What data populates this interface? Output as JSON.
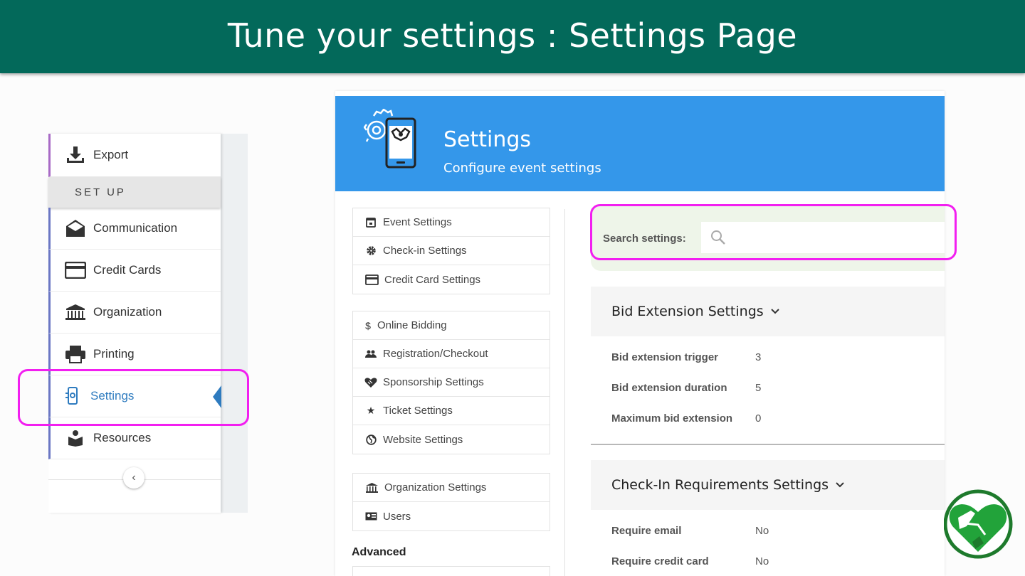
{
  "banner": {
    "title": "Tune your settings : Settings Page"
  },
  "sidebar": {
    "export_label": "Export",
    "setup_label": "SET UP",
    "items": [
      {
        "label": "Communication",
        "icon": "envelope-icon"
      },
      {
        "label": "Credit Cards",
        "icon": "credit-card-icon"
      },
      {
        "label": "Organization",
        "icon": "building-icon"
      },
      {
        "label": "Printing",
        "icon": "printer-icon"
      },
      {
        "label": "Settings",
        "icon": "phone-settings-icon",
        "active": true
      },
      {
        "label": "Resources",
        "icon": "resources-icon"
      }
    ],
    "collapse_glyph": "‹"
  },
  "panel": {
    "title": "Settings",
    "subtitle": "Configure event settings",
    "menu_groups": [
      [
        {
          "label": "Event Settings",
          "icon": "calendar-icon"
        },
        {
          "label": "Check-in Settings",
          "icon": "gear-icon"
        },
        {
          "label": "Credit Card Settings",
          "icon": "credit-card-icon"
        }
      ],
      [
        {
          "label": "Online Bidding",
          "icon": "dollar-icon"
        },
        {
          "label": "Registration/Checkout",
          "icon": "people-icon"
        },
        {
          "label": "Sponsorship Settings",
          "icon": "handshake-heart-icon"
        },
        {
          "label": "Ticket Settings",
          "icon": "star-icon"
        },
        {
          "label": "Website Settings",
          "icon": "globe-icon"
        }
      ],
      [
        {
          "label": "Organization Settings",
          "icon": "building-icon"
        },
        {
          "label": "Users",
          "icon": "id-card-icon"
        }
      ]
    ],
    "advanced_label": "Advanced",
    "search": {
      "label": "Search settings:",
      "value": "",
      "placeholder": ""
    },
    "sections": [
      {
        "title": "Bid Extension Settings",
        "rows": [
          {
            "key": "Bid extension trigger",
            "value": "3"
          },
          {
            "key": "Bid extension duration",
            "value": "5"
          },
          {
            "key": "Maximum bid extension",
            "value": "0"
          }
        ]
      },
      {
        "title": "Check-In Requirements Settings",
        "rows": [
          {
            "key": "Require email",
            "value": "No"
          },
          {
            "key": "Require credit card",
            "value": "No"
          }
        ]
      }
    ]
  },
  "colors": {
    "banner": "#03695a",
    "panel_header": "#3497ea",
    "highlight": "#f21ff0",
    "active_item": "#2e7bbf"
  }
}
